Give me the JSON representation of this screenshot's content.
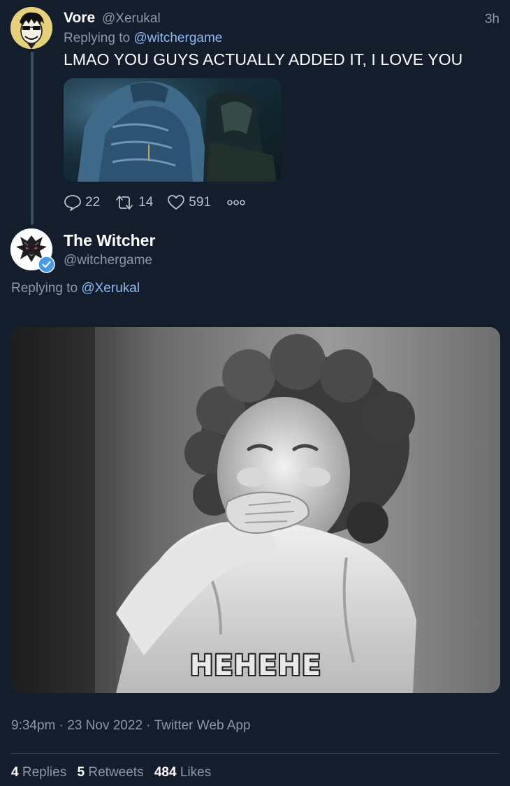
{
  "reply_tweet": {
    "author_name": "Vore",
    "author_handle": "@Xerukal",
    "time": "3h",
    "replying_prefix": "Replying to",
    "replying_to": "@witchergame",
    "text": "LMAO YOU GUYS ACTUALLY ADDED IT, I LOVE YOU",
    "media_icon": "game-screenshot",
    "actions": {
      "replies": "22",
      "retweets": "14",
      "likes": "591"
    }
  },
  "main_tweet": {
    "author_name": "The Witcher",
    "author_handle": "@witchergame",
    "verified": true,
    "replying_prefix": "Replying to",
    "replying_to": "@Xerukal",
    "gif_caption": "HEHEHE",
    "timestamp": "9:34pm",
    "date": "23 Nov 2022",
    "source": "Twitter Web App",
    "stats": {
      "replies_count": "4",
      "replies_label": "Replies",
      "retweets_count": "5",
      "retweets_label": "Retweets",
      "likes_count": "484",
      "likes_label": "Likes"
    }
  },
  "colors": {
    "background": "#141d2b",
    "link": "#8fb9f5",
    "muted": "#8b98a5",
    "verified": "#4a99e9"
  }
}
